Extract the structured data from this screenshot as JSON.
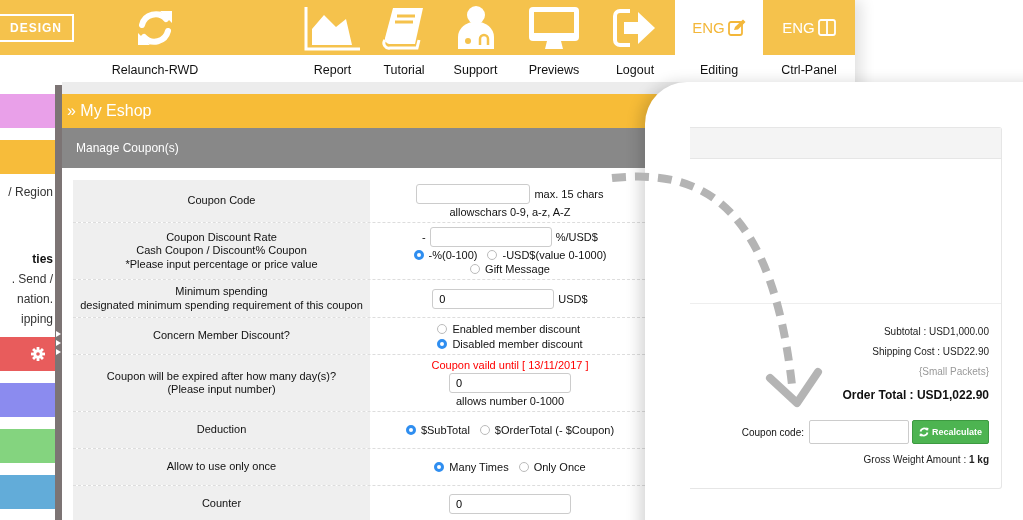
{
  "logo": {
    "text": "DESIGN"
  },
  "nav": [
    {
      "kind": "refresh",
      "label": "Relaunch-RWD",
      "selected": false
    },
    {
      "kind": "spacer"
    },
    {
      "kind": "chart",
      "label": "Report",
      "selected": false
    },
    {
      "kind": "book",
      "label": "Tutorial",
      "selected": false
    },
    {
      "kind": "doctor",
      "label": "Support",
      "selected": false
    },
    {
      "kind": "monitor",
      "label": "Previews",
      "selected": false
    },
    {
      "kind": "exit",
      "label": "Logout",
      "selected": false
    },
    {
      "kind": "edit",
      "badge": "ENG",
      "label": "Editing",
      "selected": true
    },
    {
      "kind": "columns",
      "badge": "ENG",
      "label": "Ctrl-Panel",
      "selected": false
    }
  ],
  "sidebar": {
    "items": [
      {
        "kind": "block",
        "color": "#e9a0e9"
      },
      {
        "kind": "block",
        "color": "#f7bc3a"
      },
      {
        "kind": "text",
        "text": "/ Region"
      },
      {
        "kind": "heading",
        "text": "ties"
      },
      {
        "kind": "text",
        "text": ". Send /"
      },
      {
        "kind": "text",
        "text": "nation."
      },
      {
        "kind": "text",
        "text": "ipping"
      },
      {
        "kind": "settings-block",
        "color": "#e85c5c"
      },
      {
        "kind": "block",
        "color": "#8b8bef"
      },
      {
        "kind": "block",
        "color": "#84d47f"
      },
      {
        "kind": "block",
        "color": "#62acd9"
      }
    ]
  },
  "panel": {
    "title": "» My Eshop",
    "subtitle": "Manage Coupon(s)"
  },
  "form_rows": [
    {
      "lines": [
        "Coupon Code"
      ],
      "controls": [
        {
          "kind": "input",
          "suffix": "max. 15 chars"
        },
        {
          "kind": "note",
          "text": "allowschars 0-9, a-z, A-Z"
        }
      ]
    },
    {
      "lines": [
        "Coupon Discount Rate",
        "Cash Coupon / Discount% Coupon",
        "*Please input percentage or price value"
      ],
      "controls": [
        {
          "kind": "input",
          "prefix": "-",
          "suffix": "%/USD$"
        },
        {
          "kind": "radios",
          "options": [
            {
              "label": "-%(0-100)",
              "selected": true
            },
            {
              "label": "-USD$(value 0-1000)",
              "selected": false
            }
          ]
        },
        {
          "kind": "radios",
          "options": [
            {
              "label": "Gift Message",
              "selected": false
            }
          ]
        }
      ]
    },
    {
      "lines": [
        "Minimum spending",
        "designated minimum spending requirement of this coupon"
      ],
      "controls": [
        {
          "kind": "input",
          "value": "0",
          "suffix": "USD$"
        }
      ]
    },
    {
      "lines": [
        "Concern Member Discount?"
      ],
      "controls": [
        {
          "kind": "radio-stack",
          "options": [
            {
              "label": "Enabled member discount",
              "selected": false
            },
            {
              "label": "Disabled member discount",
              "selected": true
            }
          ]
        }
      ]
    },
    {
      "lines": [
        "Coupon will be expired after how many day(s)?",
        "(Please input number)"
      ],
      "controls": [
        {
          "kind": "warning",
          "text": "Coupon vaild until [ 13/11/2017 ]"
        },
        {
          "kind": "input",
          "value": "0"
        },
        {
          "kind": "note",
          "text": "allows number 0-1000"
        }
      ]
    },
    {
      "lines": [
        "Deduction"
      ],
      "controls": [
        {
          "kind": "radios",
          "options": [
            {
              "label": "$SubTotal",
              "selected": true
            },
            {
              "label": "$OrderTotal (- $Coupon)",
              "selected": false
            }
          ]
        }
      ]
    },
    {
      "lines": [
        "Allow to use only once"
      ],
      "controls": [
        {
          "kind": "radios",
          "options": [
            {
              "label": "Many Times",
              "selected": true
            },
            {
              "label": "Only Once",
              "selected": false
            }
          ]
        }
      ]
    },
    {
      "lines": [
        "Counter"
      ],
      "controls": [
        {
          "kind": "input",
          "value": "0"
        }
      ]
    }
  ],
  "cart": {
    "totals": [
      "Subtotal : USD1,000.00",
      "Shipping Cost : USD22.90"
    ],
    "shipping_method": "{Small Packets}",
    "order_total": "Order Total : USD1,022.90",
    "coupon": {
      "label": "Coupon code:"
    },
    "button": "Recalculate",
    "weight": "Gross Weight Amount : **1 kg**"
  }
}
